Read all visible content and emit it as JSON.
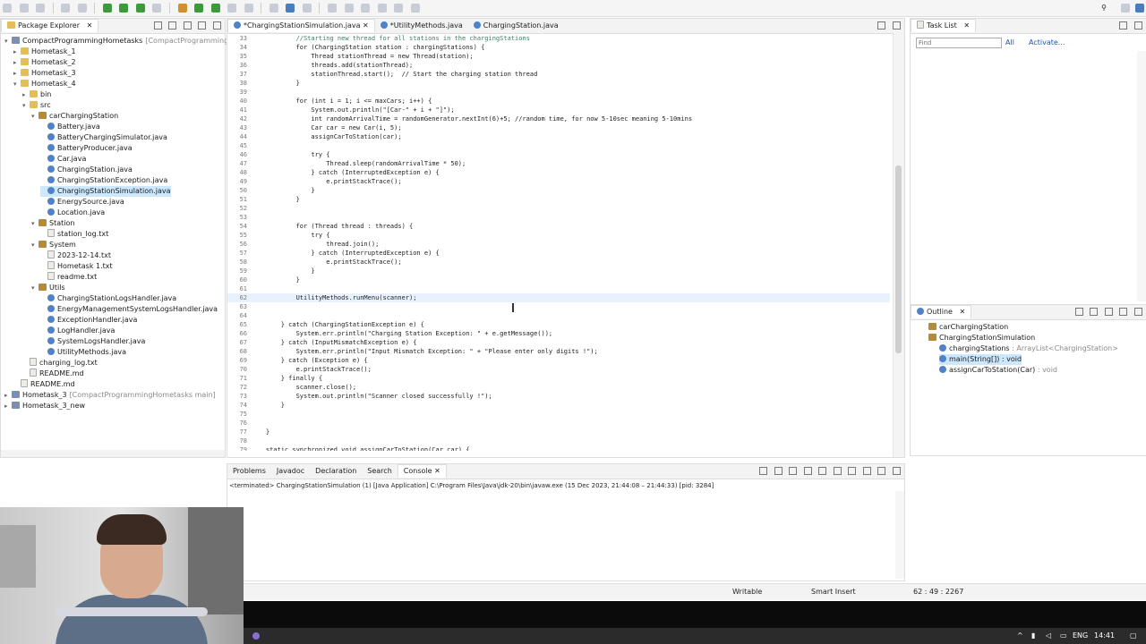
{
  "package_explorer": {
    "title": "Package Explorer",
    "tree": [
      {
        "label": "CompactProgrammingHometasks",
        "repo": "[CompactProgrammingHor",
        "icon": "project-icon",
        "level": 0,
        "tw": "▾"
      },
      {
        "label": "Hometask_1",
        "icon": "folder-icon",
        "level": 1,
        "tw": "▸"
      },
      {
        "label": "Hometask_2",
        "icon": "folder-icon",
        "level": 1,
        "tw": "▸"
      },
      {
        "label": "Hometask_3",
        "icon": "folder-icon",
        "level": 1,
        "tw": "▸"
      },
      {
        "label": "Hometask_4",
        "icon": "folder-icon",
        "level": 1,
        "tw": "▾"
      },
      {
        "label": "bin",
        "icon": "folder-icon",
        "level": 2,
        "tw": "▸"
      },
      {
        "label": "src",
        "icon": "folder-icon",
        "level": 2,
        "tw": "▾"
      },
      {
        "label": "carChargingStation",
        "icon": "package-icon",
        "level": 3,
        "tw": "▾"
      },
      {
        "label": "Battery.java",
        "icon": "java-file-icon",
        "level": 4,
        "tw": ""
      },
      {
        "label": "BatteryChargingSimulator.java",
        "icon": "java-file-icon",
        "level": 4,
        "tw": ""
      },
      {
        "label": "BatteryProducer.java",
        "icon": "java-file-icon",
        "level": 4,
        "tw": ""
      },
      {
        "label": "Car.java",
        "icon": "java-file-icon",
        "level": 4,
        "tw": ""
      },
      {
        "label": "ChargingStation.java",
        "icon": "java-file-icon",
        "level": 4,
        "tw": ""
      },
      {
        "label": "ChargingStationException.java",
        "icon": "java-file-icon",
        "level": 4,
        "tw": ""
      },
      {
        "label": "ChargingStationSimulation.java",
        "icon": "java-file-icon",
        "level": 4,
        "tw": "",
        "selected": true
      },
      {
        "label": "EnergySource.java",
        "icon": "java-file-icon",
        "level": 4,
        "tw": ""
      },
      {
        "label": "Location.java",
        "icon": "java-file-icon",
        "level": 4,
        "tw": ""
      },
      {
        "label": "Station",
        "icon": "package-icon",
        "level": 3,
        "tw": "▾"
      },
      {
        "label": "station_log.txt",
        "icon": "text-file-icon",
        "level": 4,
        "tw": ""
      },
      {
        "label": "System",
        "icon": "package-icon",
        "level": 3,
        "tw": "▾"
      },
      {
        "label": "2023-12-14.txt",
        "icon": "text-file-icon",
        "level": 4,
        "tw": ""
      },
      {
        "label": "Hometask 1.txt",
        "icon": "text-file-icon",
        "level": 4,
        "tw": ""
      },
      {
        "label": "readme.txt",
        "icon": "text-file-icon",
        "level": 4,
        "tw": ""
      },
      {
        "label": "Utils",
        "icon": "package-icon",
        "level": 3,
        "tw": "▾"
      },
      {
        "label": "ChargingStationLogsHandler.java",
        "icon": "java-file-icon",
        "level": 4,
        "tw": ""
      },
      {
        "label": "EnergyManagementSystemLogsHandler.java",
        "icon": "java-file-icon",
        "level": 4,
        "tw": ""
      },
      {
        "label": "ExceptionHandler.java",
        "icon": "java-file-icon",
        "level": 4,
        "tw": ""
      },
      {
        "label": "LogHandler.java",
        "icon": "java-file-icon",
        "level": 4,
        "tw": ""
      },
      {
        "label": "SystemLogsHandler.java",
        "icon": "java-file-icon",
        "level": 4,
        "tw": ""
      },
      {
        "label": "UtilityMethods.java",
        "icon": "java-file-icon",
        "level": 4,
        "tw": ""
      },
      {
        "label": "charging_log.txt",
        "icon": "text-file-icon",
        "level": 2,
        "tw": ""
      },
      {
        "label": "README.md",
        "icon": "text-file-icon",
        "level": 2,
        "tw": ""
      },
      {
        "label": "README.md",
        "icon": "text-file-icon",
        "level": 1,
        "tw": ""
      },
      {
        "label": "Hometask_3",
        "repo": "[CompactProgrammingHometasks main]",
        "icon": "project-icon",
        "level": 0,
        "tw": "▸"
      },
      {
        "label": "Hometask_3_new",
        "icon": "project-icon",
        "level": 0,
        "tw": "▸"
      }
    ]
  },
  "editor": {
    "tabs": [
      {
        "label": "*ChargingStationSimulation.java",
        "active": true
      },
      {
        "label": "*UtilityMethods.java",
        "active": false
      },
      {
        "label": "ChargingStation.java",
        "active": false
      }
    ],
    "lines": [
      {
        "n": "33",
        "code": "            //Starting new thread for all stations in the chargingStations",
        "cls": "cm"
      },
      {
        "n": "34",
        "code": "            for (ChargingStation station : chargingStations) {"
      },
      {
        "n": "35",
        "code": "                Thread stationThread = new Thread(station);"
      },
      {
        "n": "36",
        "code": "                threads.add(stationThread);"
      },
      {
        "n": "37",
        "code": "                stationThread.start();  // Start the charging station thread"
      },
      {
        "n": "38",
        "code": "            }"
      },
      {
        "n": "39",
        "code": ""
      },
      {
        "n": "40",
        "code": "            for (int i = 1; i <= maxCars; i++) {"
      },
      {
        "n": "41",
        "code": "                System.out.println(\"[Car-\" + i + \"]\");"
      },
      {
        "n": "42",
        "code": "                int randomArrivalTime = randomGenerator.nextInt(6)+5; //random time, for now 5-10sec meaning 5-10mins"
      },
      {
        "n": "43",
        "code": "                Car car = new Car(i, 5);"
      },
      {
        "n": "44",
        "code": "                assignCarToStation(car);"
      },
      {
        "n": "45",
        "code": ""
      },
      {
        "n": "46",
        "code": "                try {"
      },
      {
        "n": "47",
        "code": "                    Thread.sleep(randomArrivalTime * 50);"
      },
      {
        "n": "48",
        "code": "                } catch (InterruptedException e) {"
      },
      {
        "n": "49",
        "code": "                    e.printStackTrace();"
      },
      {
        "n": "50",
        "code": "                }"
      },
      {
        "n": "51",
        "code": "            }"
      },
      {
        "n": "52",
        "code": ""
      },
      {
        "n": "53",
        "code": ""
      },
      {
        "n": "54",
        "code": "            for (Thread thread : threads) {"
      },
      {
        "n": "55",
        "code": "                try {"
      },
      {
        "n": "56",
        "code": "                    thread.join();"
      },
      {
        "n": "57",
        "code": "                } catch (InterruptedException e) {"
      },
      {
        "n": "58",
        "code": "                    e.printStackTrace();"
      },
      {
        "n": "59",
        "code": "                }"
      },
      {
        "n": "60",
        "code": "            }"
      },
      {
        "n": "61",
        "code": ""
      },
      {
        "n": "62",
        "code": "            UtilityMethods.runMenu(scanner);",
        "current": true
      },
      {
        "n": "63",
        "code": ""
      },
      {
        "n": "64",
        "code": ""
      },
      {
        "n": "65",
        "code": "        } catch (ChargingStationException e) {"
      },
      {
        "n": "66",
        "code": "            System.err.println(\"Charging Station Exception: \" + e.getMessage());"
      },
      {
        "n": "67",
        "code": "        } catch (InputMismatchException e) {"
      },
      {
        "n": "68",
        "code": "            System.err.println(\"Input Mismatch Exception: \" + \"Please enter only digits !\");"
      },
      {
        "n": "69",
        "code": "        } catch (Exception e) {"
      },
      {
        "n": "70",
        "code": "            e.printStackTrace();"
      },
      {
        "n": "71",
        "code": "        } finally {"
      },
      {
        "n": "72",
        "code": "            scanner.close();"
      },
      {
        "n": "73",
        "code": "            System.out.println(\"Scanner closed successfully !\");"
      },
      {
        "n": "74",
        "code": "        }"
      },
      {
        "n": "75",
        "code": ""
      },
      {
        "n": "76",
        "code": ""
      },
      {
        "n": "77",
        "code": "    }"
      },
      {
        "n": "78",
        "code": ""
      },
      {
        "n": "79",
        "code": "    static synchronized void assignCarToStation(Car car) {"
      }
    ]
  },
  "tasklist": {
    "title": "Task List",
    "find_placeholder": "Find",
    "all_label": "All",
    "activate_label": "Activate..."
  },
  "outline": {
    "title": "Outline",
    "items": [
      {
        "label": "carChargingStation",
        "type": "",
        "level": 0
      },
      {
        "label": "ChargingStationSimulation",
        "type": "",
        "level": 0
      },
      {
        "label": "chargingStations",
        "type": " : ArrayList<ChargingStation>",
        "level": 1
      },
      {
        "label": "main(String[]) : void",
        "type": "",
        "level": 1,
        "selected": true
      },
      {
        "label": "assignCarToStation(Car)",
        "type": " : void",
        "level": 1
      }
    ]
  },
  "console": {
    "tabs": [
      "Problems",
      "Javadoc",
      "Declaration",
      "Search",
      "Console"
    ],
    "active_tab": "Console",
    "terminated": "<terminated> ChargingStationSimulation (1) [Java Application] C:\\Program Files\\Java\\jdk-20\\bin\\javaw.exe  (15 Dec 2023, 21:44:08 – 21:44:33) [pid: 3284]"
  },
  "statusbar": {
    "writable": "Writable",
    "insert_mode": "Smart Insert",
    "position": "62 : 49 : 2267"
  },
  "taskbar": {
    "lang": "ENG",
    "time": "14:41"
  }
}
